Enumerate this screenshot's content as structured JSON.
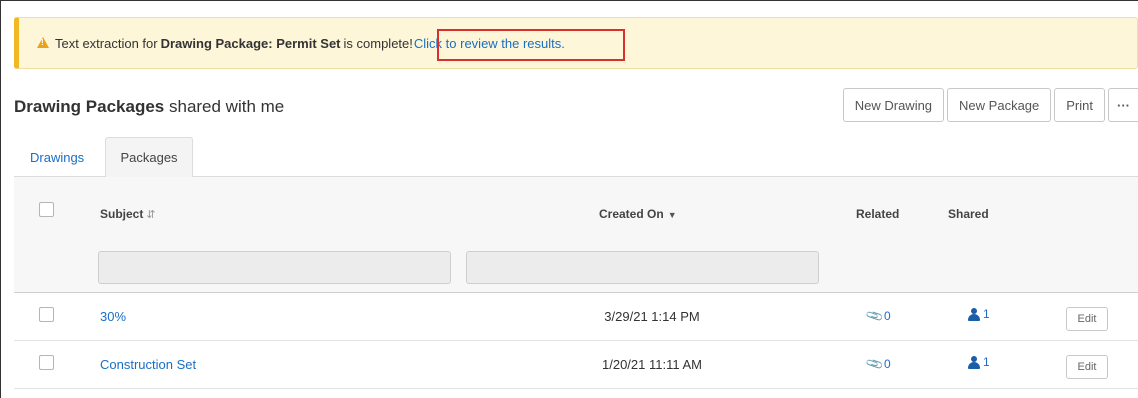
{
  "alert": {
    "prefix": "Text extraction for",
    "package_name": "Drawing Package: Permit Set",
    "suffix": "is complete!",
    "link": "Click to review the results."
  },
  "header": {
    "title_bold": "Drawing Packages",
    "title_rest": "shared with me"
  },
  "toolbar": {
    "new_drawing": "New Drawing",
    "new_package": "New Package",
    "print": "Print",
    "more": "···"
  },
  "tabs": [
    {
      "label": "Drawings",
      "active": false
    },
    {
      "label": "Packages",
      "active": true
    }
  ],
  "table": {
    "columns": {
      "subject": "Subject",
      "created_on": "Created On",
      "related": "Related",
      "shared": "Shared"
    },
    "filters": {
      "subject": "",
      "created_on": ""
    },
    "rows": [
      {
        "subject": "30%",
        "created_on": "3/29/21 1:14 PM",
        "related": "0",
        "shared": "1",
        "edit": "Edit"
      },
      {
        "subject": "Construction Set",
        "created_on": "1/20/21 11:11 AM",
        "related": "0",
        "shared": "1",
        "edit": "Edit"
      }
    ]
  },
  "colors": {
    "link": "#1a6fc4",
    "alert_bg": "#fdf6d8",
    "alert_accent": "#f2b824",
    "highlight": "#d9302c"
  }
}
